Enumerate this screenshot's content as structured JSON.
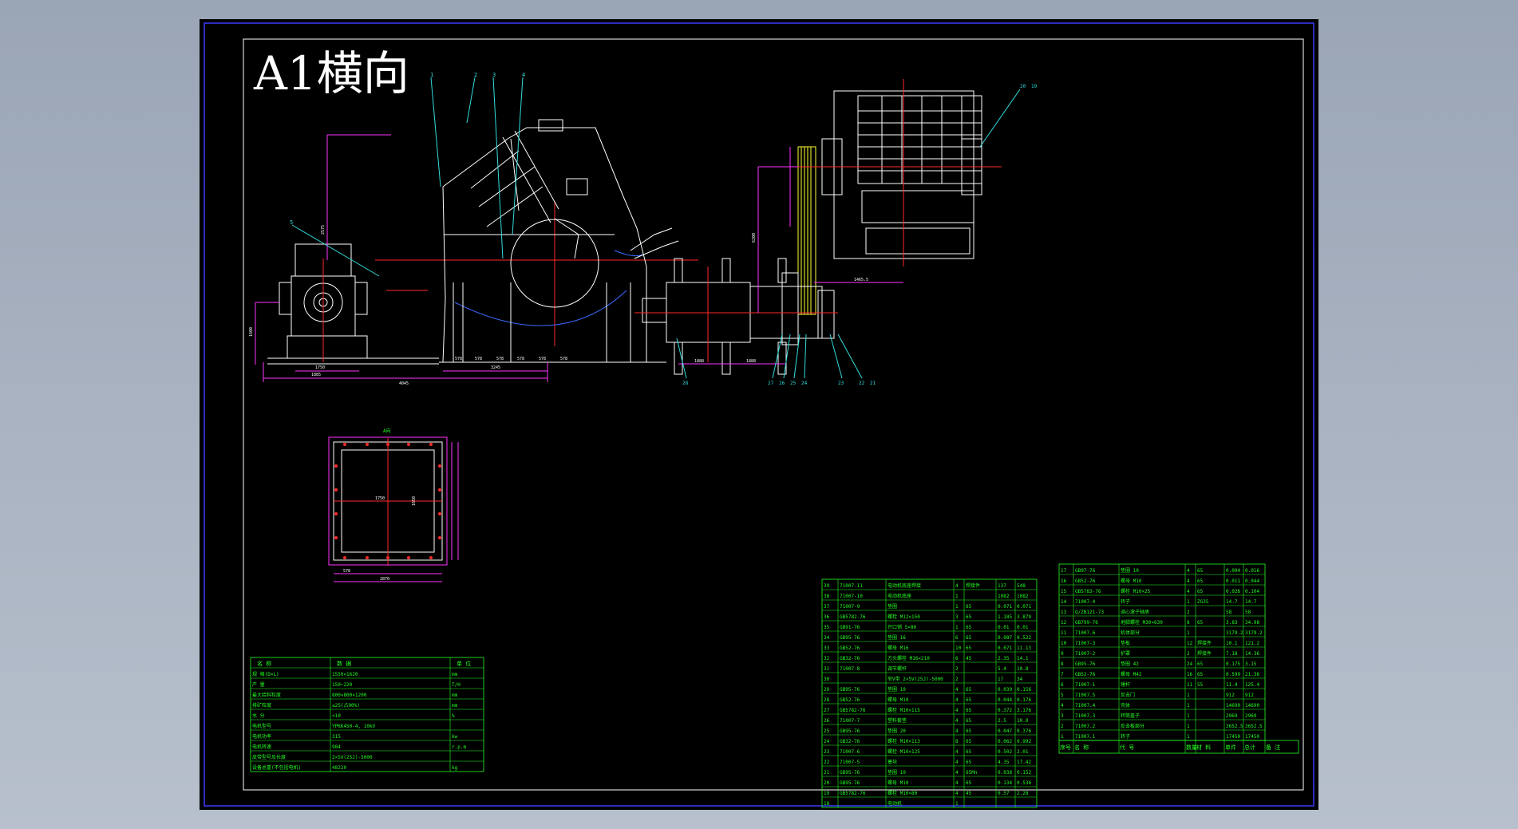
{
  "drawing": {
    "title": "A1横向",
    "colors": {
      "background_window": "#9aa5b6",
      "sheet": "#000000",
      "border": "#ffffff",
      "outer_border": "#3a3aff",
      "geometry": "#ffffff",
      "centerline": "#ff2a2a",
      "dimension": "#ff33ff",
      "leader": "#33dddd",
      "table": "#22ff22",
      "belt": "#ffff33"
    },
    "balloons_front": [
      "1",
      "2",
      "3",
      "4",
      "5"
    ],
    "balloons_top": [
      "28",
      "27",
      "26",
      "25",
      "24",
      "23",
      "22",
      "21",
      "20",
      "19"
    ],
    "section_label": "A向"
  },
  "specs": {
    "header": [
      "名 称",
      "数 据",
      "单 位"
    ],
    "rows": [
      [
        "规 格(D×L)",
        "1550×1620",
        "mm"
      ],
      [
        "产 量",
        "150~220",
        "T/H"
      ],
      [
        "最大给料粒度",
        "800×800×1200",
        "mm"
      ],
      [
        "排矿粒度",
        "≤25(占90%)",
        "mm"
      ],
      [
        "水 分",
        "<10",
        "%"
      ],
      [
        "电机型号",
        "YPKK450-4, 10kV",
        ""
      ],
      [
        "电机功率",
        "315",
        "kw"
      ],
      [
        "电机转速",
        "984",
        "r.p.m"
      ],
      [
        "皮带型号及长度",
        "2×5V(25J)-5000",
        ""
      ],
      [
        "设备总重(不包括电机)",
        "48220",
        "kg"
      ]
    ]
  },
  "bom_left": {
    "rows": [
      [
        "39",
        "71007-11",
        "电动机底座焊接",
        "4",
        "焊接件",
        "137",
        "548"
      ],
      [
        "38",
        "71007-10",
        "电动机底座",
        "1",
        "",
        "1082",
        "1082"
      ],
      [
        "37",
        "71007-9",
        "垫圈",
        "1",
        "65",
        "0.071",
        "0.071"
      ],
      [
        "36",
        "GB5782-76",
        "螺栓 M12×150",
        "3",
        "65",
        "1.185",
        "3.879"
      ],
      [
        "35",
        "GB91-76",
        "开口销 5×80",
        "1",
        "65",
        "0.01",
        "0.01"
      ],
      [
        "34",
        "GB95-76",
        "垫圈 16",
        "6",
        "65",
        "0.087",
        "0.522"
      ],
      [
        "33",
        "GB52-76",
        "螺母 M16",
        "10",
        "65",
        "0.071",
        "11.13"
      ],
      [
        "32",
        "GB32-76",
        "方头螺栓 M16×210",
        "6",
        "45",
        "2.35",
        "14.1"
      ],
      [
        "31",
        "71007-8",
        "调节螺杆",
        "2",
        "",
        "5.4",
        "10.8"
      ],
      [
        "30",
        "",
        "窄V带 2×5V(25J)-5000",
        "2",
        "",
        "17",
        "34"
      ],
      [
        "29",
        "GB95-76",
        "垫圈 10",
        "4",
        "65",
        "0.039",
        "0.156"
      ],
      [
        "28",
        "GB52-76",
        "螺母 M10",
        "4",
        "65",
        "0.044",
        "0.176"
      ],
      [
        "27",
        "GB5782-76",
        "螺栓 M10×115",
        "4",
        "65",
        "0.372",
        "3.176"
      ],
      [
        "26",
        "71007-7",
        "塑料套垫",
        "4",
        "65",
        "2.5",
        "10.0"
      ],
      [
        "25",
        "GB95-76",
        "垫圈 20",
        "4",
        "65",
        "0.047",
        "0.376"
      ],
      [
        "24",
        "GB32-76",
        "螺栓 M10×113",
        "8",
        "65",
        "0.062",
        "0.992"
      ],
      [
        "23",
        "71007-6",
        "螺栓 M10×125",
        "4",
        "65",
        "0.502",
        "2.01"
      ],
      [
        "22",
        "71007-5",
        "塞块",
        "4",
        "65",
        "4.35",
        "17.42"
      ],
      [
        "21",
        "GB95-76",
        "垫圈 10",
        "4",
        "65Mn",
        "0.038",
        "0.152"
      ],
      [
        "20",
        "GB95-76",
        "螺母 M10",
        "4",
        "65",
        "0.134",
        "0.536"
      ],
      [
        "19",
        "GB5782-76",
        "螺栓 M10×80",
        "4",
        "45",
        "0.57",
        "2.28"
      ],
      [
        "18",
        "",
        "电动机",
        "1",
        "",
        "",
        ""
      ]
    ]
  },
  "bom_right": {
    "rows": [
      [
        "17",
        "GB97-76",
        "垫圈 10",
        "4",
        "65",
        "0.004",
        "0.016"
      ],
      [
        "16",
        "GB52-76",
        "螺母 M10",
        "4",
        "65",
        "0.011",
        "0.044"
      ],
      [
        "15",
        "GB5783-76",
        "螺栓 M10×25",
        "4",
        "65",
        "0.026",
        "0.104"
      ],
      [
        "14",
        "71007-4",
        "转子",
        "1",
        "ZG35",
        "14.7",
        "14.7"
      ],
      [
        "13",
        "Q/ZB121-73",
        "调心滚子轴承",
        "2",
        "",
        "58",
        "58"
      ],
      [
        "12",
        "GB799-76",
        "地脚螺栓 M30×630",
        "8",
        "65",
        "3.83",
        "34.98"
      ],
      [
        "11",
        "71007.6",
        "机体部分",
        "1",
        "",
        "3179.2",
        "3179.2"
      ],
      [
        "10",
        "71007-3",
        "垫板",
        "12",
        "焊接件",
        "10.1",
        "121.2"
      ],
      [
        "9",
        "71007-2",
        "护罩",
        "2",
        "焊接件",
        "7.18",
        "14.36"
      ],
      [
        "8",
        "GB95-76",
        "垫圈 42",
        "24",
        "65",
        "0.175",
        "3.15"
      ],
      [
        "7",
        "GB52-76",
        "螺母 M42",
        "16",
        "65",
        "0.599",
        "21.36"
      ],
      [
        "6",
        "71007-1",
        "锤杆",
        "11",
        "55",
        "11.4",
        "125.4"
      ],
      [
        "5",
        "71007.5",
        "反击门",
        "1",
        "",
        "912",
        "912"
      ],
      [
        "4",
        "71007.4",
        "壳体",
        "1",
        "",
        "14690",
        "14690"
      ],
      [
        "3",
        "71007.3",
        "转筒盖子",
        "1",
        "",
        "2969",
        "2969"
      ],
      [
        "2",
        "71007.2",
        "反击板部分",
        "1",
        "",
        "3652.5",
        "3652.5"
      ],
      [
        "1",
        "71007.1",
        "转子",
        "1",
        "",
        "17450",
        "17450"
      ]
    ],
    "header": [
      "序号",
      "名 称",
      "代 号",
      "数量",
      "材 料",
      "单件",
      "总计",
      "备 注"
    ]
  },
  "dims": {
    "front_base": [
      "1750",
      "1885",
      "4045",
      "3245"
    ],
    "front_spacing": [
      "578",
      "578",
      "578",
      "578",
      "578",
      "578"
    ],
    "front_height": [
      "2575",
      "1600"
    ],
    "section": [
      "1750",
      "2870",
      "1650",
      "578"
    ],
    "top": [
      "1888",
      "1888",
      "1465.5",
      "6200"
    ]
  }
}
